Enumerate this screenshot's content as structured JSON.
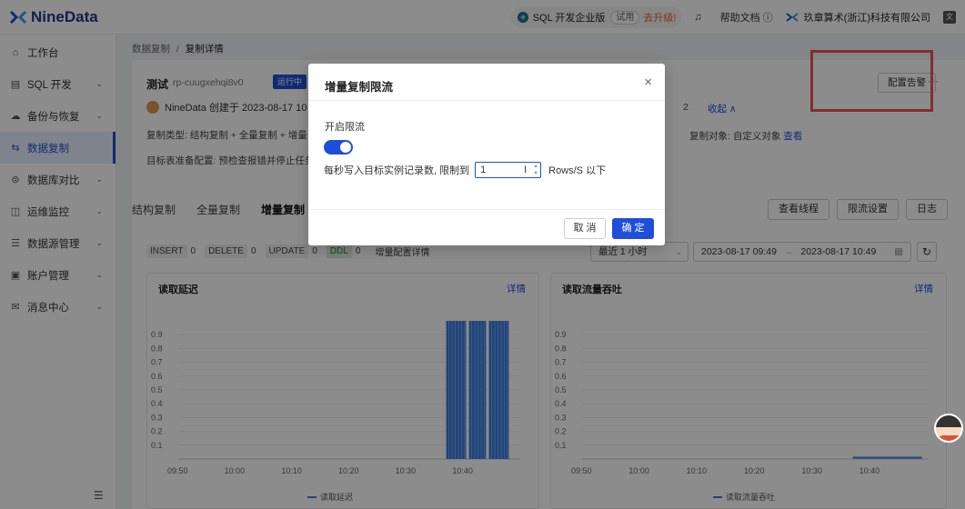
{
  "app": {
    "logo_text": "NineData"
  },
  "topbar": {
    "edition_name": "SQL 开发企业版",
    "trial_label": "试用",
    "upgrade_label": "去升级!",
    "help_label": "帮助文档",
    "org_name": "玖章算术(浙江)科技有限公司"
  },
  "sidebar": {
    "items": [
      {
        "label": "工作台",
        "icon": "home-icon"
      },
      {
        "label": "SQL 开发",
        "icon": "sql-console-icon"
      },
      {
        "label": "备份与恢复",
        "icon": "backup-cloud-icon"
      },
      {
        "label": "数据复制",
        "icon": "replication-icon"
      },
      {
        "label": "数据库对比",
        "icon": "compare-icon"
      },
      {
        "label": "运维监控",
        "icon": "monitor-icon"
      },
      {
        "label": "数据源管理",
        "icon": "datasource-icon"
      },
      {
        "label": "账户管理",
        "icon": "account-icon"
      },
      {
        "label": "消息中心",
        "icon": "message-icon"
      }
    ],
    "active_index": 3
  },
  "breadcrumb": {
    "parent": "数据复制",
    "separator": "/",
    "current": "复制详情"
  },
  "task": {
    "name": "测试",
    "id": "rp-cuugxehqi8v0",
    "status": "运行中",
    "creator_line": "NineData 创建于 2023-08-17 10",
    "copy_types": "复制类型: 结构复制 + 全量复制 + 增量",
    "target_prep": "目标表准备配置: 预检查报错并停止任务",
    "collapse_number": "2",
    "collapse_label": "收起",
    "copy_object_label": "复制对象: 自定义对象",
    "copy_object_link": "查看",
    "alert_button": "配置告警",
    "more_label": "···"
  },
  "tabs": {
    "items": [
      "结构复制",
      "全量复制",
      "增量复制"
    ],
    "active_index": 2,
    "actions": [
      "查看线程",
      "限流设置",
      "日志"
    ]
  },
  "stats": {
    "insert_label": "INSERT",
    "insert_count": "0",
    "delete_label": "DELETE",
    "delete_count": "0",
    "update_label": "UPDATE",
    "update_count": "0",
    "ddl_label": "DDL",
    "ddl_count": "0",
    "details_label": "增量配置详情"
  },
  "time_filter": {
    "range": "最近 1 小时",
    "start": "2023-08-17 09:49",
    "arrow": "→",
    "end": "2023-08-17 10:49"
  },
  "charts": {
    "left": {
      "title": "读取延迟",
      "detail_link": "详情",
      "legend": "读取延迟"
    },
    "right": {
      "title": "读取流量吞吐",
      "detail_link": "详情",
      "legend": "读取流量吞吐"
    }
  },
  "chart_data": [
    {
      "type": "bar",
      "title": "读取延迟",
      "ylim": [
        0,
        1
      ],
      "y_ticks": [
        "0.9",
        "0.8",
        "0.7",
        "0.6",
        "0.5",
        "0.4",
        "0.3",
        "0.2",
        "0.1"
      ],
      "x_ticks": [
        "09:50",
        "10:00",
        "10:10",
        "10:20",
        "10:30",
        "10:40"
      ],
      "series": [
        {
          "name": "读取延迟",
          "color": "#3b7de0",
          "segments": [
            {
              "start": "10:37",
              "end": "10:40:30",
              "value": 1
            },
            {
              "start": "10:41",
              "end": "10:44",
              "value": 1
            },
            {
              "start": "10:44:30",
              "end": "10:48",
              "value": 1
            }
          ]
        }
      ]
    },
    {
      "type": "line",
      "title": "读取流量吞吐",
      "ylim": [
        0,
        1
      ],
      "y_ticks": [
        "0.9",
        "0.8",
        "0.7",
        "0.6",
        "0.5",
        "0.4",
        "0.3",
        "0.2",
        "0.1"
      ],
      "x_ticks": [
        "09:50",
        "10:00",
        "10:10",
        "10:20",
        "10:30",
        "10:40"
      ],
      "series": [
        {
          "name": "读取流量吞吐",
          "color": "#3b7de0",
          "points": [
            {
              "x": "10:37",
              "y": 0.01
            },
            {
              "x": "10:49",
              "y": 0.01
            }
          ]
        }
      ]
    }
  ],
  "modal": {
    "title": "增量复制限流",
    "close_icon": "×",
    "enable_label": "开启限流",
    "enabled": true,
    "rate_prefix": "每秒写入目标实例记录数, 限制到",
    "rate_value": "1",
    "rate_suffix": "Rows/S 以下",
    "cancel_label": "取 消",
    "ok_label": "确 定"
  },
  "colors": {
    "accent": "#1f4fd8",
    "alert_box": "#f05252",
    "chart": "#3b7de0"
  }
}
